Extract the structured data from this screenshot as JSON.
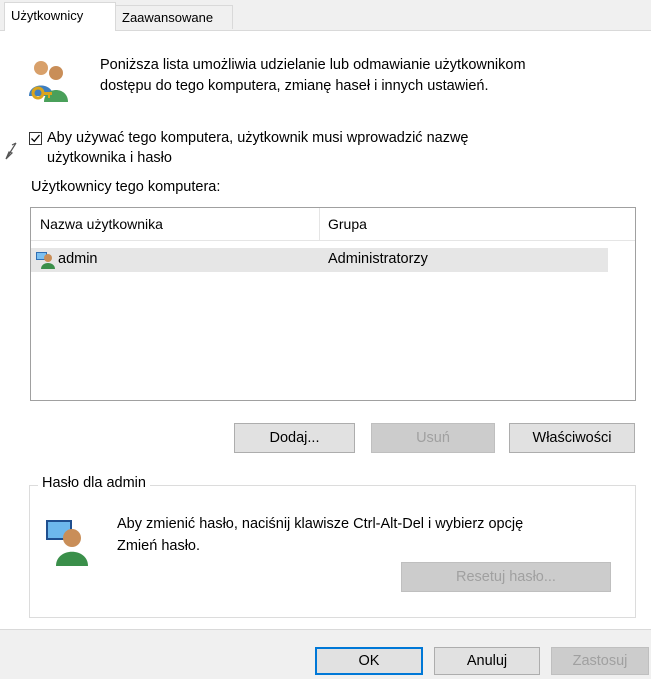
{
  "tabs": [
    {
      "label": "Użytkownicy",
      "active": true
    },
    {
      "label": "Zaawansowane",
      "active": false
    }
  ],
  "intro": {
    "icon": "users-key-icon",
    "text_line1": "Poniższa lista umożliwia udzielanie lub odmawianie użytkownikom",
    "text_line2": "dostępu do tego komputera, zmianę haseł i innych ustawień."
  },
  "require_password": {
    "checked": true,
    "label_line1": "Aby używać tego komputera, użytkownik musi wprowadzić nazwę",
    "label_line2": "użytkownika i hasło"
  },
  "users_list": {
    "label": "Użytkownicy tego komputera:",
    "columns": [
      "Nazwa użytkownika",
      "Grupa"
    ],
    "rows": [
      {
        "name": "admin",
        "group": "Administratorzy",
        "icon": "user-admin-icon",
        "selected": true
      }
    ]
  },
  "list_buttons": {
    "add": "Dodaj...",
    "remove": "Usuń",
    "properties": "Właściwości"
  },
  "password_group": {
    "title": "Hasło dla admin",
    "icon": "user-icon",
    "text_line1": "Aby zmienić hasło, naciśnij klawisze Ctrl-Alt-Del i wybierz opcję",
    "text_line2": "Zmień hasło.",
    "reset_button": "Resetuj hasło..."
  },
  "footer": {
    "ok": "OK",
    "cancel": "Anuluj",
    "apply": "Zastosuj"
  },
  "colors": {
    "panel_bg": "#ffffff",
    "window_bg": "#f0f0f0",
    "selected_row": "#e6e6e6",
    "default_button_border": "#0078d7",
    "disabled_text": "#a0a0a0"
  }
}
